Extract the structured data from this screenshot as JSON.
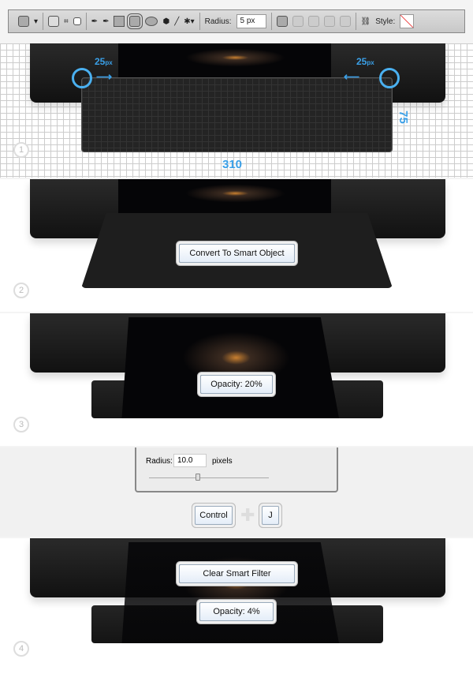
{
  "toolbar": {
    "radius_label": "Radius:",
    "radius_value": "5 px",
    "style_label": "Style:"
  },
  "step1": {
    "badge": "1",
    "left_offset": "25",
    "right_offset": "25",
    "unit": "px",
    "width": "310",
    "height": "75"
  },
  "step2": {
    "badge": "2",
    "button": "Convert To Smart Object"
  },
  "step3": {
    "badge": "3",
    "opacity": "Opacity: 20%"
  },
  "blur_dialog": {
    "radius_label": "Radius:",
    "radius_value": "10.0",
    "unit": "pixels",
    "slider_value": 0.4
  },
  "shortcut": {
    "key1": "Control",
    "key2": "J"
  },
  "step4": {
    "badge": "4",
    "button": "Clear Smart Filter",
    "opacity": "Opacity: 4%"
  }
}
